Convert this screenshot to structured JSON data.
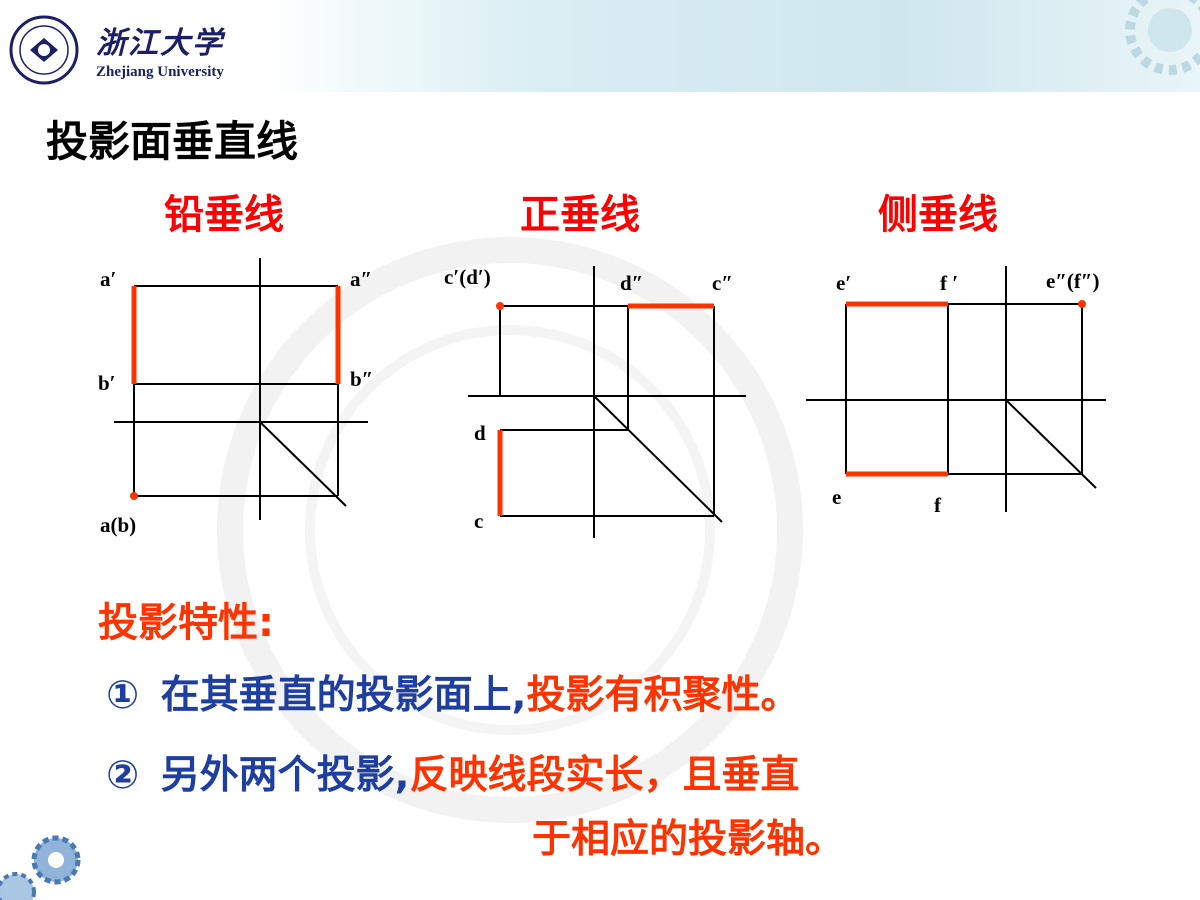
{
  "header": {
    "university_cn": "浙江大学",
    "university_en": "Zhejiang University",
    "logo_text": "1897 ZHEJIANG UNIVERSITY"
  },
  "title": "投影面垂直线",
  "subtitles": [
    "铅垂线",
    "正垂线",
    "侧垂线"
  ],
  "diagram1": {
    "labels": {
      "a1": "a′",
      "a2": "a″",
      "b1": "b′",
      "b2": "b″",
      "ab": "a(b)"
    }
  },
  "diagram2": {
    "labels": {
      "cd1": "c′(d′)",
      "d2": "d″",
      "c2": "c″",
      "d": "d",
      "c": "c"
    }
  },
  "diagram3": {
    "labels": {
      "e1": "e′",
      "f1": "f ′",
      "ef2": "e″(f″)",
      "e": "e",
      "f": "f"
    }
  },
  "properties": {
    "heading": "投影特性:",
    "item1": {
      "num": "①",
      "text": "在其垂直的投影面上,",
      "highlight": "投影有积聚性。"
    },
    "item2": {
      "num": "②",
      "text": "另外两个投影,",
      "highlight": "反映线段实长，且垂直",
      "highlight2": "于相应的投影轴。"
    }
  },
  "colors": {
    "accent": "#ff0000",
    "line": "#ff3300",
    "body": "#1f3fa0",
    "logo": "#1b1f66"
  }
}
